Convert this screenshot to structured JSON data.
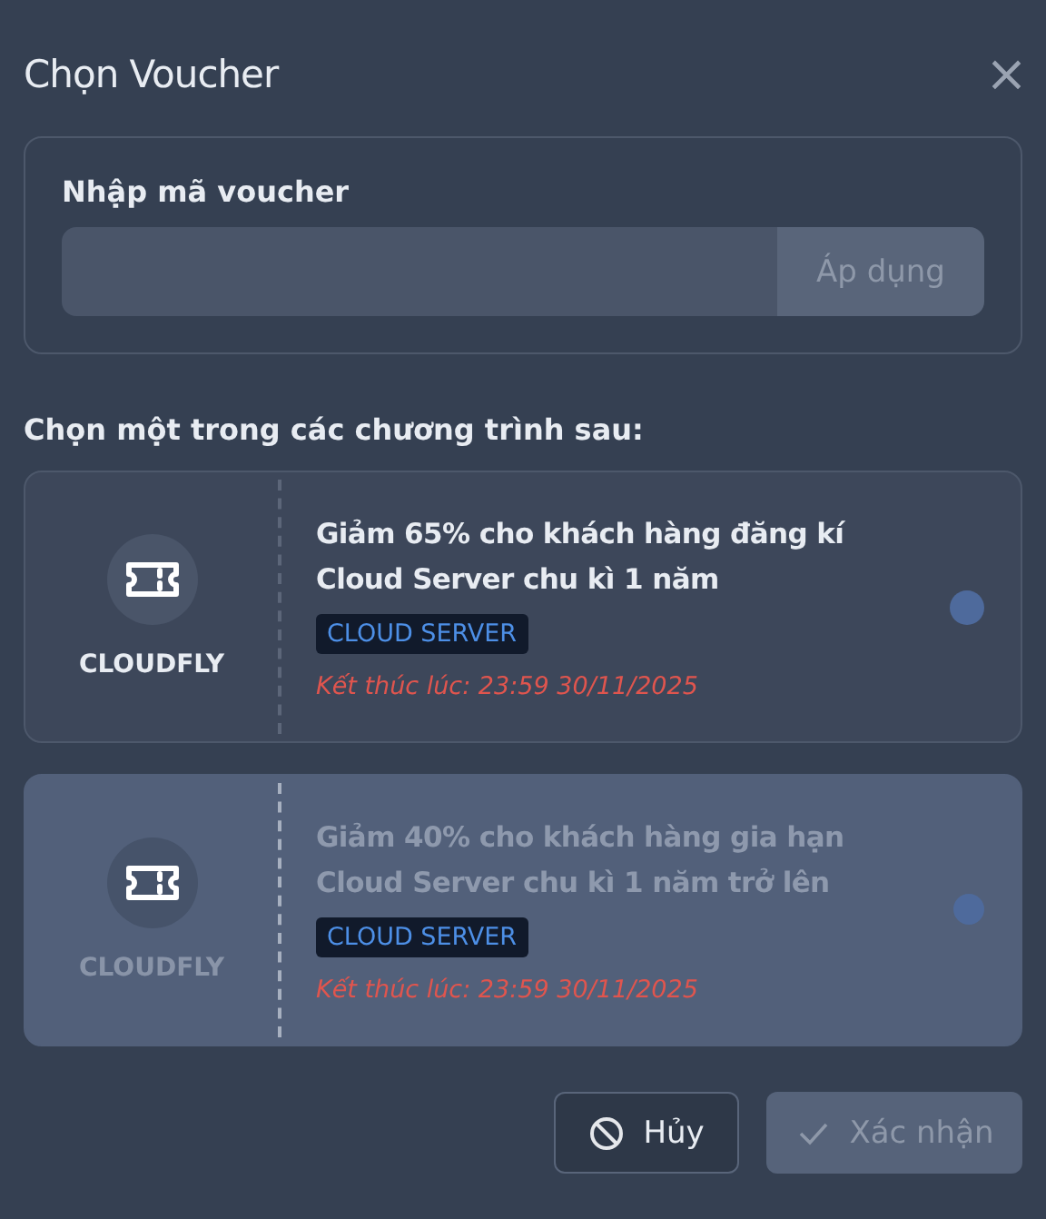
{
  "dialog": {
    "title": "Chọn Voucher",
    "close": "×"
  },
  "code_entry": {
    "label": "Nhập mã voucher",
    "apply_button": {
      "label": "Áp dụng",
      "disabled": true
    }
  },
  "section_label": "Chọn một trong các chương trình sau:",
  "vouchers": [
    {
      "brand": "CLOUDFLY",
      "title": "Giảm 65% cho khách hàng đăng kí Cloud Server chu kì 1 năm",
      "tag": "CLOUD SERVER",
      "expiry": "Kết thúc lúc: 23:59 30/11/2025",
      "disabled": false,
      "selected": false
    },
    {
      "brand": "CLOUDFLY",
      "title": "Giảm 40% cho khách hàng gia hạn Cloud Server chu kì 1 năm trở lên",
      "tag": "CLOUD SERVER",
      "expiry": "Kết thúc lúc: 23:59 30/11/2025",
      "disabled": true,
      "selected": false
    }
  ],
  "buttons": {
    "cancel": {
      "label": "Hủy"
    },
    "confirm": {
      "label": "Xác nhận",
      "disabled": true
    }
  }
}
